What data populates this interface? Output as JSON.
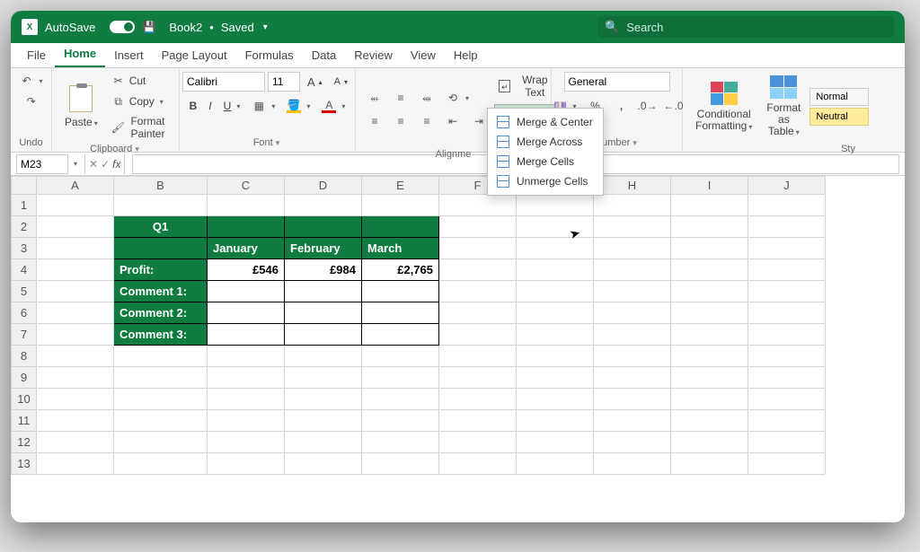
{
  "titlebar": {
    "autosave_label": "AutoSave",
    "autosave_state": "On",
    "doc_name": "Book2",
    "saved_state": "Saved",
    "search_placeholder": "Search"
  },
  "tabs": [
    "File",
    "Home",
    "Insert",
    "Page Layout",
    "Formulas",
    "Data",
    "Review",
    "View",
    "Help"
  ],
  "active_tab": "Home",
  "ribbon": {
    "undo": {
      "name": "Undo"
    },
    "clipboard": {
      "name": "Clipboard",
      "paste": "Paste",
      "cut": "Cut",
      "copy": "Copy",
      "format_painter": "Format Painter"
    },
    "font": {
      "name": "Font",
      "font_name": "Calibri",
      "font_size": "11",
      "b": "B",
      "i": "I",
      "u": "U"
    },
    "alignment": {
      "name": "Alignme",
      "wrap_text": "Wrap Text",
      "merge_center": "Merge & Center"
    },
    "merge_menu": {
      "items": [
        "Merge & Center",
        "Merge Across",
        "Merge Cells",
        "Unmerge Cells"
      ]
    },
    "number": {
      "name": "Number",
      "format": "General"
    },
    "styles": {
      "name": "Sty",
      "conditional_formatting": "Conditional Formatting",
      "format_as_table": "Format as Table",
      "normal": "Normal",
      "neutral": "Neutral"
    }
  },
  "formula_bar": {
    "name_box": "M23",
    "formula": ""
  },
  "grid": {
    "columns": [
      "A",
      "B",
      "C",
      "D",
      "E",
      "F",
      "G",
      "H",
      "I",
      "J"
    ],
    "rows": [
      1,
      2,
      3,
      4,
      5,
      6,
      7,
      8,
      9,
      10,
      11,
      12,
      13
    ],
    "table": {
      "title": "Q1",
      "headers": [
        "January",
        "February",
        "March"
      ],
      "row_profit_label": "Profit:",
      "row_profit_values": [
        "£546",
        "£984",
        "£2,765"
      ],
      "comment_labels": [
        "Comment 1:",
        "Comment 2:",
        "Comment 3:"
      ]
    }
  }
}
